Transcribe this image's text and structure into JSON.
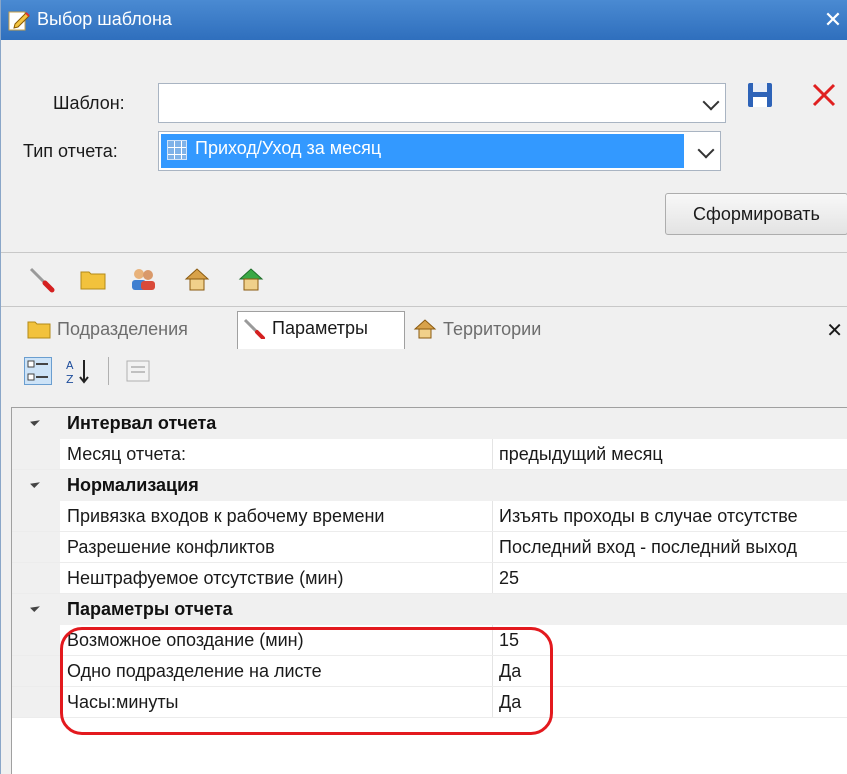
{
  "window": {
    "title": "Выбор шаблона",
    "close_glyph": "✕"
  },
  "form": {
    "template_label": "Шаблон:",
    "template_value": "",
    "report_type_label": "Тип отчета:",
    "report_type_value": "Приход/Уход за месяц",
    "generate_button": "Сформировать"
  },
  "tabs": [
    {
      "label": "Подразделения",
      "icon": "folder-icon",
      "active": false
    },
    {
      "label": "Параметры",
      "icon": "wrench-icon",
      "active": true
    },
    {
      "label": "Территории",
      "icon": "house-icon",
      "active": false
    }
  ],
  "tabs_close_glyph": "✕",
  "property_grid": {
    "categories": [
      {
        "name": "Интервал отчета",
        "props": [
          {
            "name": "Месяц отчета:",
            "value": "предыдущий месяц"
          }
        ]
      },
      {
        "name": "Нормализация",
        "props": [
          {
            "name": "Привязка входов к рабочему времени",
            "value": "Изъять проходы в случае отсутстве"
          },
          {
            "name": "Разрешение конфликтов",
            "value": "Последний вход - последний выход"
          },
          {
            "name": "Нештрафуемое отсутствие (мин)",
            "value": "25"
          }
        ]
      },
      {
        "name": "Параметры отчета",
        "props": [
          {
            "name": "Возможное опоздание (мин)",
            "value": "15"
          },
          {
            "name": "Одно подразделение на листе",
            "value": "Да"
          },
          {
            "name": "Часы:минуты",
            "value": "Да"
          }
        ]
      }
    ]
  },
  "colors": {
    "titlebar": "#2f6fbd",
    "selection": "#3399ff",
    "highlight": "#e3191e"
  }
}
